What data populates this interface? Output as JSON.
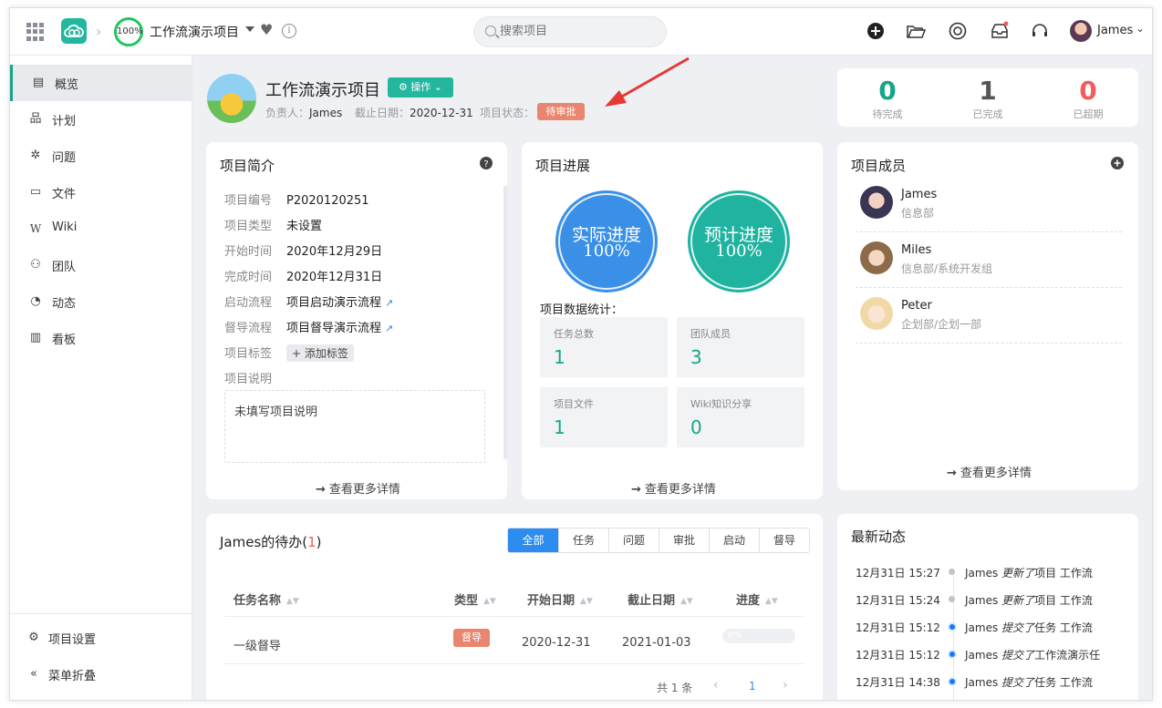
{
  "topbar": {
    "progress_ring": "100%",
    "project_name": "工作流演示项目",
    "search_placeholder": "搜索项目",
    "user_name": "James"
  },
  "sidebar": {
    "items": [
      {
        "icon": "overview-icon",
        "label": "概览"
      },
      {
        "icon": "plan-icon",
        "label": "计划"
      },
      {
        "icon": "bug-icon",
        "label": "问题"
      },
      {
        "icon": "folder-icon",
        "label": "文件"
      },
      {
        "icon": "wiki-icon",
        "label": "Wiki"
      },
      {
        "icon": "team-icon",
        "label": "团队"
      },
      {
        "icon": "activity-icon",
        "label": "动态"
      },
      {
        "icon": "board-icon",
        "label": "看板"
      }
    ],
    "settings": "项目设置",
    "collapse": "菜单折叠"
  },
  "header": {
    "title": "工作流演示项目",
    "op_button": "操作",
    "owner_label": "负责人：",
    "owner": "James",
    "due_label": "截止日期：",
    "due": "2020-12-31",
    "status_label": "项目状态：",
    "status": "待审批"
  },
  "stats": [
    {
      "value": "0",
      "label": "待完成",
      "color": "#17a589"
    },
    {
      "value": "1",
      "label": "已完成",
      "color": "#555555"
    },
    {
      "value": "0",
      "label": "已超期",
      "color": "#f45b5b"
    }
  ],
  "intro": {
    "title": "项目简介",
    "fields": [
      {
        "k": "项目编号",
        "v": "P2020120251"
      },
      {
        "k": "项目类型",
        "v": "未设置"
      },
      {
        "k": "开始时间",
        "v": "2020年12月29日"
      },
      {
        "k": "完成时间",
        "v": "2020年12月31日"
      },
      {
        "k": "启动流程",
        "v": "项目启动演示流程"
      },
      {
        "k": "督导流程",
        "v": "项目督导演示流程"
      },
      {
        "k": "项目标签",
        "v": "+ 添加标签"
      },
      {
        "k": "项目说明",
        "v": ""
      }
    ],
    "description": "未填写项目说明",
    "more": "查看更多详情"
  },
  "progress": {
    "title": "项目进展",
    "actual_label": "实际进度",
    "actual_value": "100%",
    "plan_label": "预计进度",
    "plan_value": "100%",
    "stats_title": "项目数据统计：",
    "cells": [
      {
        "label": "任务总数",
        "value": "1"
      },
      {
        "label": "团队成员",
        "value": "3"
      },
      {
        "label": "项目文件",
        "value": "1"
      },
      {
        "label": "Wiki知识分享",
        "value": "0"
      }
    ],
    "more": "查看更多详情"
  },
  "members": {
    "title": "项目成员",
    "list": [
      {
        "name": "James",
        "dept": "信息部"
      },
      {
        "name": "Miles",
        "dept": "信息部/系统开发组"
      },
      {
        "name": "Peter",
        "dept": "企划部/企划一部"
      }
    ],
    "more": "查看更多详情"
  },
  "todo": {
    "title_prefix": "James的待办(",
    "count": "1",
    "title_suffix": ")",
    "filters": [
      "全部",
      "任务",
      "问题",
      "审批",
      "启动",
      "督导"
    ],
    "columns": [
      "任务名称",
      "类型",
      "开始日期",
      "截止日期",
      "进度"
    ],
    "rows": [
      {
        "name": "一级督导",
        "type": "督导",
        "start": "2020-12-31",
        "end": "2021-01-03",
        "progress": "0%"
      }
    ],
    "pager_total": "共 1 条",
    "pager_page": "1"
  },
  "activity": {
    "title": "最新动态",
    "items": [
      {
        "time": "12月31日 15:27",
        "who": "James",
        "verb": "更新了",
        "rest": "项目 工作流"
      },
      {
        "time": "12月31日 15:24",
        "who": "James",
        "verb": "更新了",
        "rest": "项目 工作流"
      },
      {
        "time": "12月31日 15:12",
        "who": "James",
        "verb": "提交了",
        "rest": "任务 工作流"
      },
      {
        "time": "12月31日 15:12",
        "who": "James",
        "verb": "提交了",
        "rest": "工作流演示任"
      },
      {
        "time": "12月31日 14:38",
        "who": "James",
        "verb": "提交了",
        "rest": "任务 工作流"
      }
    ]
  }
}
